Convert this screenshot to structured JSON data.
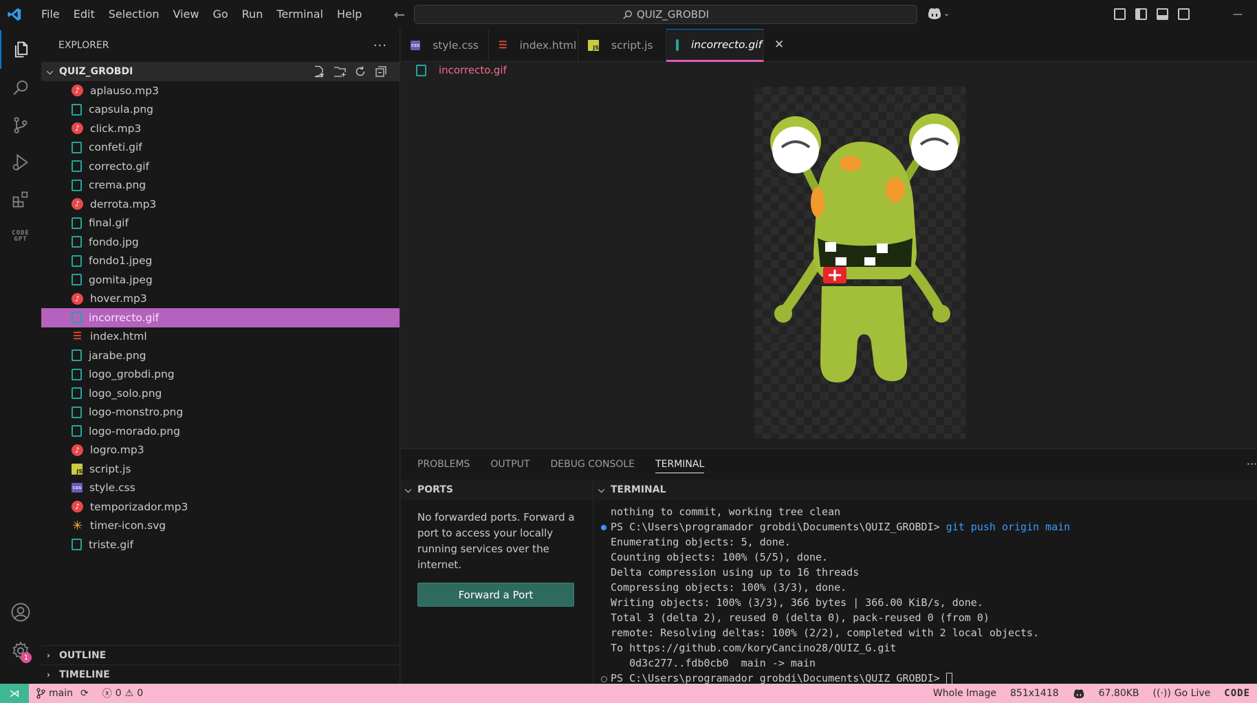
{
  "menu": [
    "File",
    "Edit",
    "Selection",
    "View",
    "Go",
    "Run",
    "Terminal",
    "Help"
  ],
  "search": {
    "text": "QUIZ_GROBDI"
  },
  "sidebar": {
    "title": "EXPLORER",
    "folder": "QUIZ_GROBDI",
    "files": [
      {
        "name": "aplauso.mp3",
        "type": "audio"
      },
      {
        "name": "capsula.png",
        "type": "img"
      },
      {
        "name": "click.mp3",
        "type": "audio"
      },
      {
        "name": "confeti.gif",
        "type": "img"
      },
      {
        "name": "correcto.gif",
        "type": "img"
      },
      {
        "name": "crema.png",
        "type": "img"
      },
      {
        "name": "derrota.mp3",
        "type": "audio"
      },
      {
        "name": "final.gif",
        "type": "img"
      },
      {
        "name": "fondo.jpg",
        "type": "img"
      },
      {
        "name": "fondo1.jpeg",
        "type": "img"
      },
      {
        "name": "gomita.jpeg",
        "type": "img"
      },
      {
        "name": "hover.mp3",
        "type": "audio"
      },
      {
        "name": "incorrecto.gif",
        "type": "img",
        "selected": true
      },
      {
        "name": "index.html",
        "type": "html"
      },
      {
        "name": "jarabe.png",
        "type": "img"
      },
      {
        "name": "logo_grobdi.png",
        "type": "img"
      },
      {
        "name": "logo_solo.png",
        "type": "img"
      },
      {
        "name": "logo-monstro.png",
        "type": "img"
      },
      {
        "name": "logo-morado.png",
        "type": "img"
      },
      {
        "name": "logro.mp3",
        "type": "audio"
      },
      {
        "name": "script.js",
        "type": "js"
      },
      {
        "name": "style.css",
        "type": "css"
      },
      {
        "name": "temporizador.mp3",
        "type": "audio"
      },
      {
        "name": "timer-icon.svg",
        "type": "svg"
      },
      {
        "name": "triste.gif",
        "type": "img"
      }
    ],
    "outline": "OUTLINE",
    "timeline": "TIMELINE"
  },
  "tabs": [
    {
      "label": "style.css",
      "type": "css"
    },
    {
      "label": "index.html",
      "type": "html"
    },
    {
      "label": "script.js",
      "type": "js"
    },
    {
      "label": "incorrecto.gif",
      "type": "img",
      "active": true
    }
  ],
  "breadcrumb": "incorrecto.gif",
  "panel": {
    "tabs": [
      "PROBLEMS",
      "OUTPUT",
      "DEBUG CONSOLE",
      "TERMINAL"
    ],
    "active_tab": "TERMINAL",
    "ports_header": "PORTS",
    "ports_message": "No forwarded ports. Forward a port to access your locally running services over the internet.",
    "forward_button": "Forward a Port",
    "terminal_header": "TERMINAL",
    "terminal_lines": [
      {
        "text": "nothing to commit, working tree clean"
      },
      {
        "prompt": "PS C:\\Users\\programador grobdi\\Documents\\QUIZ_GROBDI> ",
        "cmd": "git push origin main",
        "marker": "blue"
      },
      {
        "text": "Enumerating objects: 5, done."
      },
      {
        "text": "Counting objects: 100% (5/5), done."
      },
      {
        "text": "Delta compression using up to 16 threads"
      },
      {
        "text": "Compressing objects: 100% (3/3), done."
      },
      {
        "text": "Writing objects: 100% (3/3), 366 bytes | 366.00 KiB/s, done."
      },
      {
        "text": "Total 3 (delta 2), reused 0 (delta 0), pack-reused 0 (from 0)"
      },
      {
        "text": "remote: Resolving deltas: 100% (2/2), completed with 2 local objects."
      },
      {
        "text": "To https://github.com/koryCancino28/QUIZ_G.git"
      },
      {
        "text": "   0d3c277..fdb0cb0  main -> main"
      },
      {
        "prompt": "PS C:\\Users\\programador grobdi\\Documents\\QUIZ_GROBDI> ",
        "marker": "hollow",
        "cursor": true
      }
    ]
  },
  "status": {
    "branch": "main",
    "errors": "0",
    "warnings": "0",
    "zoom": "Whole Image",
    "dimensions": "851x1418",
    "size": "67.80KB",
    "golive": "Go Live",
    "codegpt": "CODE"
  },
  "activity": {
    "codegpt_top": "CODE",
    "codegpt_bottom": "GPT",
    "settings_badge": "1"
  },
  "colors": {
    "accent": "#0078d4",
    "status_bg": "#f9b8cf",
    "selection": "#b561be",
    "remote": "#3fb795"
  }
}
